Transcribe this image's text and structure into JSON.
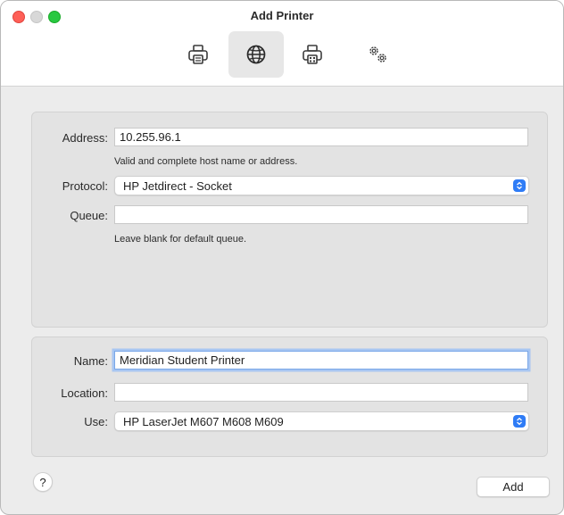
{
  "window": {
    "title": "Add Printer"
  },
  "toolbar": {
    "items": [
      {
        "icon": "printer-icon",
        "active": false
      },
      {
        "icon": "globe-icon",
        "active": true
      },
      {
        "icon": "fax-icon",
        "active": false
      },
      {
        "icon": "gears-icon",
        "active": false
      }
    ]
  },
  "connection": {
    "address_label": "Address:",
    "address_value": "10.255.96.1",
    "address_hint": "Valid and complete host name or address.",
    "protocol_label": "Protocol:",
    "protocol_value": "HP Jetdirect - Socket",
    "queue_label": "Queue:",
    "queue_value": "",
    "queue_hint": "Leave blank for default queue."
  },
  "details": {
    "name_label": "Name:",
    "name_value": "Meridian Student Printer",
    "location_label": "Location:",
    "location_value": "",
    "use_label": "Use:",
    "use_value": "HP LaserJet M607 M608 M609"
  },
  "footer": {
    "help_label": "?",
    "add_label": "Add"
  },
  "colors": {
    "accent": "#2f7cf6",
    "close": "#fe5f57",
    "maximize": "#28c840",
    "focus_ring": "#a8c6f2"
  }
}
